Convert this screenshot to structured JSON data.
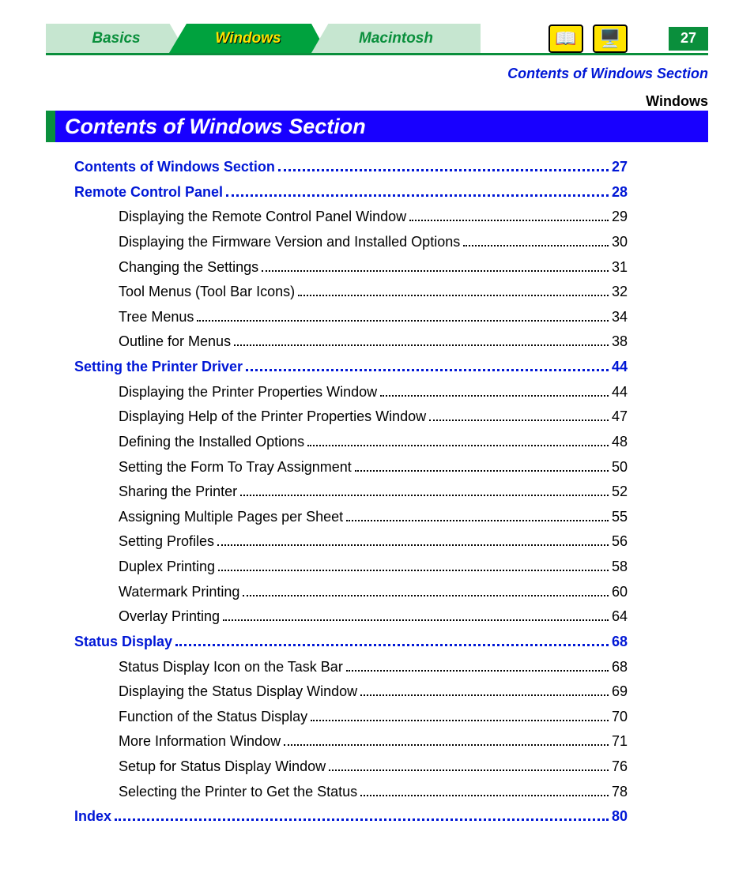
{
  "nav": {
    "basics": "Basics",
    "windows": "Windows",
    "macintosh": "Macintosh",
    "book_icon": "📖",
    "net_icon": "🖥️",
    "page_number": "27"
  },
  "breadcrumb": "Contents of Windows Section",
  "section_label": "Windows",
  "title": "Contents of Windows Section",
  "toc": [
    {
      "type": "section",
      "title": "Contents of Windows Section",
      "page": "27"
    },
    {
      "type": "section",
      "title": "Remote Control Panel",
      "page": "28"
    },
    {
      "type": "sub",
      "title": "Displaying the Remote Control Panel Window",
      "page": "29"
    },
    {
      "type": "sub",
      "title": "Displaying the Firmware Version and Installed Options",
      "page": "30"
    },
    {
      "type": "sub",
      "title": "Changing the Settings",
      "page": "31"
    },
    {
      "type": "sub",
      "title": "Tool Menus (Tool Bar Icons)",
      "page": "32"
    },
    {
      "type": "sub",
      "title": "Tree Menus",
      "page": "34"
    },
    {
      "type": "sub",
      "title": "Outline for Menus",
      "page": "38"
    },
    {
      "type": "section",
      "title": "Setting the Printer Driver",
      "page": "44"
    },
    {
      "type": "sub",
      "title": "Displaying the Printer Properties Window",
      "page": "44"
    },
    {
      "type": "sub",
      "title": "Displaying Help of the Printer Properties Window",
      "page": "47"
    },
    {
      "type": "sub",
      "title": "Defining the Installed Options",
      "page": "48"
    },
    {
      "type": "sub",
      "title": "Setting the Form To Tray Assignment",
      "page": "50"
    },
    {
      "type": "sub",
      "title": "Sharing the Printer",
      "page": "52"
    },
    {
      "type": "sub",
      "title": "Assigning Multiple Pages per Sheet",
      "page": "55"
    },
    {
      "type": "sub",
      "title": "Setting Profiles",
      "page": "56"
    },
    {
      "type": "sub",
      "title": "Duplex Printing",
      "page": "58"
    },
    {
      "type": "sub",
      "title": "Watermark Printing",
      "page": "60"
    },
    {
      "type": "sub",
      "title": "Overlay Printing",
      "page": "64"
    },
    {
      "type": "section",
      "title": "Status Display",
      "page": "68"
    },
    {
      "type": "sub",
      "title": "Status Display Icon on the Task Bar",
      "page": "68"
    },
    {
      "type": "sub",
      "title": "Displaying the Status Display Window",
      "page": "69"
    },
    {
      "type": "sub",
      "title": " Function of the Status Display",
      "page": "70"
    },
    {
      "type": "sub",
      "title": "More Information Window",
      "page": "71"
    },
    {
      "type": "sub",
      "title": " Setup for Status Display Window",
      "page": "76"
    },
    {
      "type": "sub",
      "title": " Selecting the Printer to Get the Status",
      "page": "78"
    },
    {
      "type": "section",
      "title": "Index",
      "page": "80"
    }
  ]
}
